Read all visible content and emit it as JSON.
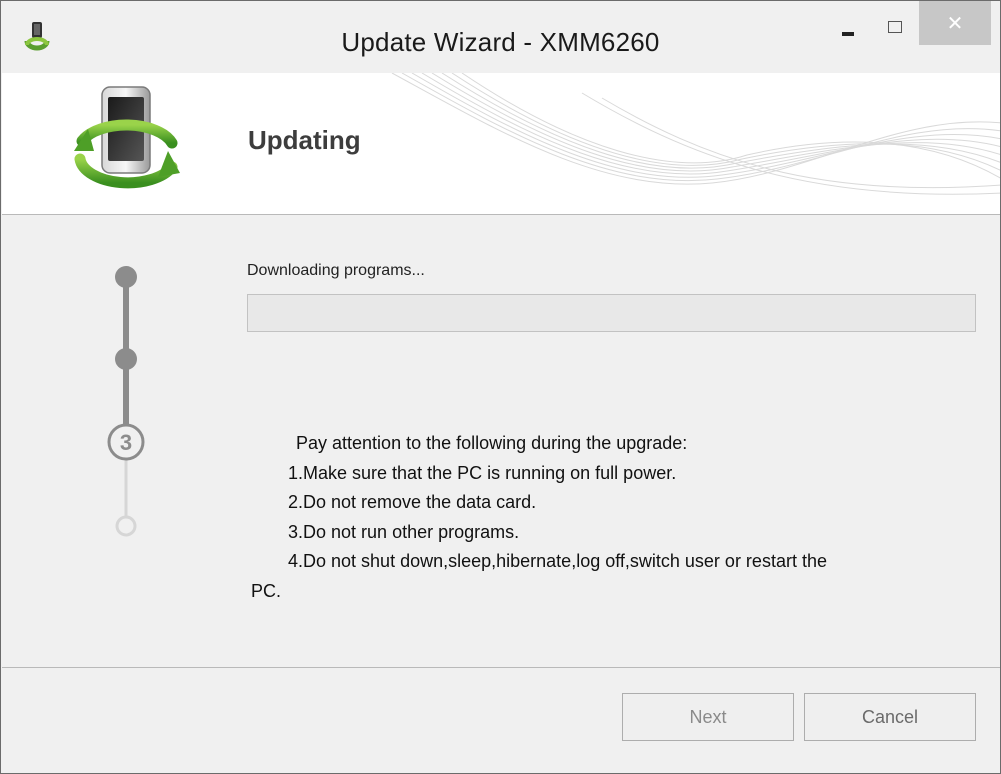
{
  "window": {
    "title": "Update Wizard - XMM6260",
    "close_glyph": "✕",
    "icons": [
      "phone-update-icon",
      "minimize-icon",
      "maximize-icon",
      "close-icon"
    ]
  },
  "header": {
    "title": "Updating",
    "icon": "phone-sync-icon"
  },
  "steps": {
    "current_label": "3",
    "current_index": 3,
    "total": 4
  },
  "progress": {
    "label": "Downloading programs...",
    "value": 0,
    "color": "#3cb043"
  },
  "notes": {
    "heading": "Pay attention to the following during the upgrade:",
    "items": [
      "1.Make sure that the PC is running on full power.",
      "2.Do not remove the data card.",
      "3.Do not run other programs.",
      "4.Do not shut down,sleep,hibernate,log off,switch user or restart the"
    ],
    "wrap": "PC."
  },
  "buttons": {
    "next": "Next",
    "cancel": "Cancel"
  }
}
